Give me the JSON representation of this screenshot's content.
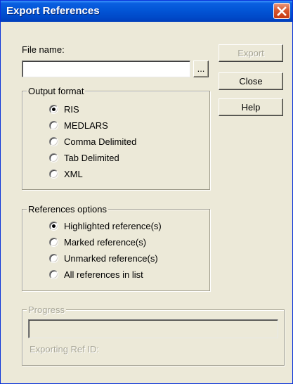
{
  "window": {
    "title": "Export References"
  },
  "file": {
    "label": "File name:",
    "value": "",
    "browse_label": "..."
  },
  "buttons": {
    "export": "Export",
    "close": "Close",
    "help": "Help"
  },
  "output_format": {
    "legend": "Output format",
    "selected": "RIS",
    "options": [
      "RIS",
      "MEDLARS",
      "Comma Delimited",
      "Tab Delimited",
      "XML"
    ]
  },
  "references_options": {
    "legend": "References options",
    "selected": "Highlighted reference(s)",
    "options": [
      "Highlighted reference(s)",
      "Marked reference(s)",
      "Unmarked reference(s)",
      "All references in list"
    ]
  },
  "progress": {
    "legend": "Progress",
    "status_label": "Exporting Ref ID:",
    "value": 0
  },
  "icons": {
    "close": "close-icon"
  },
  "colors": {
    "titlebar": "#0054e3",
    "face": "#ece9d8",
    "close_button": "#d9582f",
    "disabled_text": "#a8a696"
  }
}
